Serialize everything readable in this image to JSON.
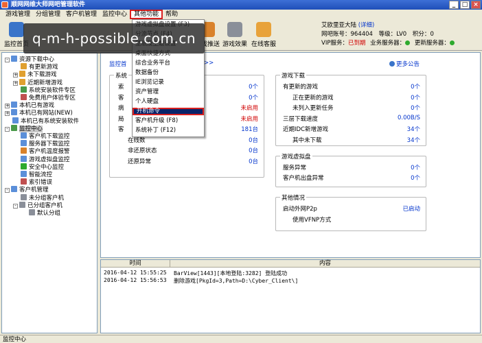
{
  "window": {
    "title": "顺网网维大师网吧管理软件",
    "controls": [
      "_",
      "□",
      "×"
    ]
  },
  "menubar": {
    "items": [
      "游戏管理",
      "分组管理",
      "客户机管理",
      "监控中心",
      "其他功能",
      "帮助"
    ],
    "active": "其他功能"
  },
  "toolbar": {
    "buttons": [
      {
        "label": "监控首页",
        "icon": "monitor-home-icon",
        "color": "#3a74c9"
      },
      {
        "label": "游戏推送",
        "icon": "push-icon",
        "color": "#d9822b"
      },
      {
        "label": "游戏效果",
        "icon": "gamepad-icon",
        "color": "#8a8f99"
      },
      {
        "label": "在线客服",
        "icon": "support-icon",
        "color": "#e8a23a"
      }
    ]
  },
  "watermark": "q-m-h-possible.com.cn",
  "user": {
    "name": "艾欧里亚大陆",
    "detail_link": "(详细)",
    "account_label": "网吧账号：",
    "account": "964404",
    "level_label": "等级：",
    "level": "LV0",
    "points_label": "积分：",
    "points": "0",
    "vip_label": "VIP服务：",
    "vip_status": "已到期",
    "biz_label": "业务服务器：",
    "update_label": "更新服务器："
  },
  "dropdown": {
    "items": [
      "游戏虚拟盘设置 (F3)",
      "分流节点 (F4)",
      "壁纸及主题设置",
      "桌面快捷方式",
      "综合业务平台",
      "数据备份",
      "IE浏览记录",
      "资产管理",
      "个人硬盘",
      "开机命令",
      "客户机升级 (F8)",
      "系统补丁 (F12)"
    ],
    "highlighted": "开机命令"
  },
  "tree": {
    "nodes": [
      {
        "label": "资源下载中心",
        "level": 0,
        "toggle": "-",
        "icon": "#5b8fd9"
      },
      {
        "label": "有更新游戏",
        "level": 1,
        "toggle": "",
        "icon": "#e0a030"
      },
      {
        "label": "未下载游戏",
        "level": 1,
        "toggle": "+",
        "icon": "#e0a030"
      },
      {
        "label": "近期新增游戏",
        "level": 1,
        "toggle": "+",
        "icon": "#e0a030"
      },
      {
        "label": "系统安装软件专区",
        "level": 1,
        "toggle": "",
        "icon": "#4a9a4a"
      },
      {
        "label": "免费用户体验专区",
        "level": 1,
        "toggle": "",
        "icon": "#c05050"
      },
      {
        "label": "本机已有游戏",
        "level": 0,
        "toggle": "+",
        "icon": "#5b8fd9"
      },
      {
        "label": "本机已有网站(NEW)",
        "level": 0,
        "toggle": "+",
        "icon": "#5b8fd9"
      },
      {
        "label": "本机已有系统安装软件",
        "level": 0,
        "toggle": "",
        "icon": "#5b8fd9"
      },
      {
        "label": "监控中心",
        "level": 0,
        "toggle": "-",
        "icon": "#4a9a4a",
        "selected": true
      },
      {
        "label": "客户机下载监控",
        "level": 1,
        "toggle": "",
        "icon": "#5b8fd9"
      },
      {
        "label": "服务器下载监控",
        "level": 1,
        "toggle": "",
        "icon": "#5b8fd9"
      },
      {
        "label": "客户机温度报警",
        "level": 1,
        "toggle": "",
        "icon": "#d9822b"
      },
      {
        "label": "游戏虚拟盘监控",
        "level": 1,
        "toggle": "",
        "icon": "#5b8fd9"
      },
      {
        "label": "安全中心监控",
        "level": 1,
        "toggle": "",
        "icon": "#2eaa2e"
      },
      {
        "label": "智能流控",
        "level": 1,
        "toggle": "",
        "icon": "#5b8fd9"
      },
      {
        "label": "索引错误",
        "level": 1,
        "toggle": "",
        "icon": "#c05050"
      },
      {
        "label": "客户机管理",
        "level": 0,
        "toggle": "-",
        "icon": "#5b8fd9"
      },
      {
        "label": "未分组客户机",
        "level": 1,
        "toggle": "",
        "icon": "#8a8f99"
      },
      {
        "label": "已分组客户机",
        "level": 1,
        "toggle": "-",
        "icon": "#8a8f99"
      },
      {
        "label": "默认分组",
        "level": 2,
        "toggle": "",
        "icon": "#8a8f99"
      }
    ]
  },
  "main": {
    "tab_partial": "监控首",
    "tab_arrows": ">>",
    "more_notice": "更多公告",
    "system_group": {
      "title": "系统",
      "rows": [
        {
          "label": "索",
          "value": "0个",
          "red": false
        },
        {
          "label": "客",
          "value": "0个",
          "red": false
        },
        {
          "label": "病",
          "value": "未启用",
          "red": true
        },
        {
          "label": "局",
          "value": "未启用",
          "red": true
        },
        {
          "label": "客",
          "value": "181台",
          "red": false
        },
        {
          "label": "在线数",
          "value": "0台",
          "red": false
        },
        {
          "label": "非还原状态",
          "value": "0台",
          "red": false
        },
        {
          "label": "还原异常",
          "value": "0台",
          "red": false
        }
      ]
    },
    "game_download": {
      "title": "游戏下载",
      "rows": [
        {
          "label": "有更新的游戏",
          "value": "0个",
          "indent": false
        },
        {
          "label": "正在更新的游戏",
          "value": "0个",
          "indent": true
        },
        {
          "label": "未列入更新任务",
          "value": "0个",
          "indent": true
        },
        {
          "label": "三层下载速度",
          "value": "0.00B/S",
          "indent": false
        },
        {
          "label": "近期IDC新增游戏",
          "value": "34个",
          "indent": false
        },
        {
          "label": "其中未下载",
          "value": "34个",
          "indent": true
        }
      ]
    },
    "virtual_disk": {
      "title": "游戏虚拟盘",
      "rows": [
        {
          "label": "服务异常",
          "value": "0个"
        },
        {
          "label": "客户机出盘异常",
          "value": "0个"
        }
      ]
    },
    "other": {
      "title": "其他情况",
      "rows": [
        {
          "label": "启动外网P2p",
          "value": "已启动"
        },
        {
          "label": "使用VFNP方式",
          "value": ""
        }
      ]
    }
  },
  "log": {
    "columns": [
      "时间",
      "内容"
    ],
    "rows": [
      {
        "time": "2016-04-12 15:55:25",
        "content": "BarView[1443][本地登陆:3282] 登陆成功"
      },
      {
        "time": "2016-04-12 15:56:53",
        "content": "删除游戏[PkgId=3,Path=D:\\Cyber_Client\\]"
      }
    ]
  },
  "statusbar": {
    "text": "监控中心"
  }
}
